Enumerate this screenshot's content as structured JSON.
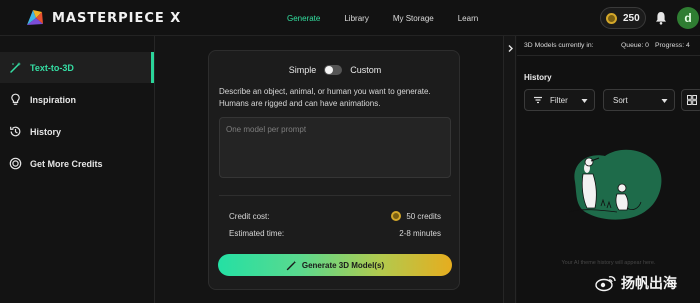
{
  "brand": {
    "name": "MASTERPIECE X",
    "logo_icon": "masterpiece-logo"
  },
  "nav": {
    "items": [
      {
        "label": "Generate",
        "active": true
      },
      {
        "label": "Library",
        "active": false
      },
      {
        "label": "My Storage",
        "active": false
      },
      {
        "label": "Learn",
        "active": false
      }
    ]
  },
  "header": {
    "credits": "250",
    "credits_icon": "coin-icon",
    "notification_icon": "bell-icon",
    "avatar_initial": "d",
    "avatar_color": "#2f7d32"
  },
  "sidebar": {
    "items": [
      {
        "label": "Text-to-3D",
        "icon": "magic-wand-icon",
        "active": true
      },
      {
        "label": "Inspiration",
        "icon": "lightbulb-icon",
        "active": false
      },
      {
        "label": "History",
        "icon": "history-icon",
        "active": false
      },
      {
        "label": "Get More Credits",
        "icon": "credits-icon",
        "active": false
      }
    ]
  },
  "generator": {
    "mode_simple": "Simple",
    "mode_custom": "Custom",
    "mode_value": "Simple",
    "description": "Describe an object, animal, or human you want to generate. Humans are rigged and can have animations.",
    "prompt_placeholder": "One model per prompt",
    "prompt_value": "",
    "credit_cost_label": "Credit cost:",
    "credit_cost_value": "50 credits",
    "estimated_time_label": "Estimated time:",
    "estimated_time_value": "2-8 minutes",
    "generate_button": "Generate 3D Model(s)"
  },
  "right_panel": {
    "queue_label": "3D Models currently in:",
    "queue": "Queue: 0",
    "progress": "Progress: 4",
    "history_title": "History",
    "filter_label": "Filter",
    "sort_label": "Sort",
    "empty_text": "Your AI theme history will appear here."
  },
  "watermark": {
    "text": "扬帆出海",
    "icon": "weibo-icon"
  },
  "colors": {
    "accent": "#2bd59a",
    "gradient_start": "#24e0a4",
    "gradient_end": "#e6ad1f",
    "background": "#141414",
    "panel": "#1c1c1c"
  }
}
